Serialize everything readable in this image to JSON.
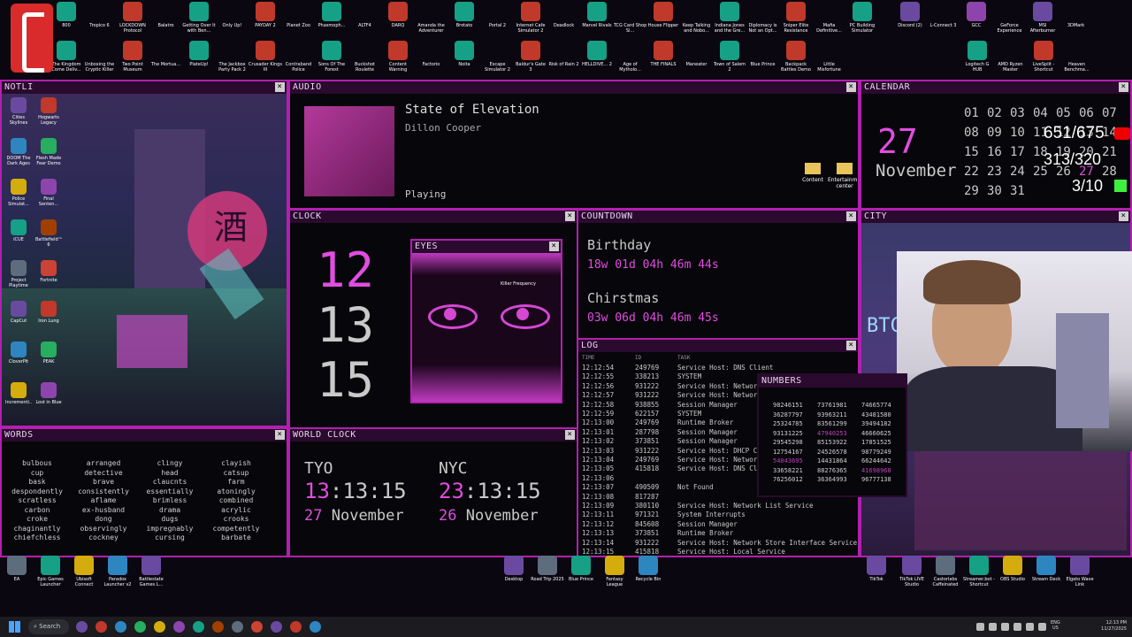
{
  "desktop_top_row1": [
    "800",
    "Tropico 6",
    "LOCKDOWN Protocol",
    "Balatro",
    "Getting Over It with Ben...",
    "Only Up!",
    "PAYDAY 2",
    "Planet Zoo",
    "Phasmoph...",
    "ALTF4",
    "DARQ",
    "Amanda the Adventurer",
    "Brotato",
    "Portal 2",
    "Internet Cafe Simulator 2",
    "Deadlock",
    "Marvel Rivals",
    "TCG Card Shop Si...",
    "House Flipper",
    "Keep Talking and Nobo...",
    "Indiana Jones and the Gre...",
    "Diplomacy is Not an Opt...",
    "Sniper Elite Resistance",
    "Mafia Definitive...",
    "PC Building Simulator",
    "Discord (2)",
    "L-Connect 3",
    "GCC",
    "GeForce Experience",
    "MSI Afterburner",
    "3DMark"
  ],
  "desktop_top_row2": [
    "The Kingdom Come Deliv...",
    "Unboxing the Cryptic Killer",
    "Two Point Museum",
    "The Mortua...",
    "PlateUp!",
    "The Jackbox Party Pack 2",
    "Crusader Kings III",
    "Contraband Police",
    "Sons Of The Forest",
    "Buckshot Roulette",
    "Content Warning",
    "Factorio",
    "Noita",
    "Escape Simulator 2",
    "Baldur's Gate 3",
    "Risk of Rain 2",
    "HELLDIVE... 2",
    "Age of Mytholo...",
    "THE FINALS",
    "Maneater",
    "Town of Salem 2",
    "Blue Prince",
    "Backpack Battles Demo",
    "Little Misfortune",
    "Logitech G HUB",
    "AMD Ryzen Master",
    "LiveSplit - Shortcut",
    "Heaven Benchma..."
  ],
  "audio": {
    "title": "AUDIO",
    "track": "State of Elevation",
    "artist": "Dillon Cooper",
    "status": "Playing",
    "folder1": "Content",
    "folder2": "Entertainm... center"
  },
  "calendar": {
    "title": "CALENDAR",
    "day": "27",
    "month": "November",
    "dates": [
      "01",
      "02",
      "03",
      "04",
      "05",
      "06",
      "07",
      "08",
      "09",
      "10",
      "11",
      "12",
      "13",
      "14",
      "15",
      "16",
      "17",
      "18",
      "19",
      "20",
      "21",
      "22",
      "23",
      "24",
      "25",
      "26",
      "27",
      "28",
      "29",
      "30",
      "31"
    ]
  },
  "overlay": {
    "counter1": "651/675",
    "counter2": "313/320",
    "counter3": "3/10"
  },
  "clock": {
    "title": "CLOCK",
    "h": "12",
    "m": "13",
    "s": "15"
  },
  "eyes": {
    "title": "EYES",
    "caption": "Killer Frequency"
  },
  "countdown": {
    "title": "COUNTDOWN",
    "e1_name": "Birthday",
    "e1_time": "18w 01d 04h 46m 44s",
    "e2_name": "Chirstmas",
    "e2_time": "03w 06d 04h 46m 45s"
  },
  "city": {
    "title": "CITY",
    "sign": "BTC"
  },
  "log": {
    "title": "LOG",
    "col_time": "TIME",
    "col_id": "ID",
    "col_task": "TASK",
    "rows": [
      [
        "12:12:54",
        "249769",
        "Service Host: DNS Client"
      ],
      [
        "12:12:55",
        "338213",
        "SYSTEM"
      ],
      [
        "12:12:56",
        "931222",
        "Service Host: Networ"
      ],
      [
        "12:12:57",
        "931222",
        "Service Host: Networ"
      ],
      [
        "12:12:58",
        "938855",
        "Session Manager"
      ],
      [
        "12:12:59",
        "622157",
        "SYSTEM"
      ],
      [
        "12:13:00",
        "249769",
        "Runtime Broker"
      ],
      [
        "12:13:01",
        "287798",
        "Session Manager"
      ],
      [
        "12:13:02",
        "373851",
        "Session Manager"
      ],
      [
        "12:13:03",
        "931222",
        "Service Host: DHCP C"
      ],
      [
        "12:13:04",
        "249769",
        "Service Host: Networ"
      ],
      [
        "12:13:05",
        "415818",
        "Service Host: DNS Cl"
      ],
      [
        "12:13:06",
        "",
        ""
      ],
      [
        "12:13:07",
        "490509",
        "Not Found"
      ],
      [
        "12:13:08",
        "817287",
        ""
      ],
      [
        "12:13:09",
        "380110",
        "Service Host: Network List Service"
      ],
      [
        "12:13:11",
        "971321",
        "System Interrupts"
      ],
      [
        "12:13:12",
        "845608",
        "Session Manager"
      ],
      [
        "12:13:13",
        "373851",
        "Runtime Broker"
      ],
      [
        "12:13:14",
        "931222",
        "Service Host: Network Store Interface Service"
      ],
      [
        "12:13:15",
        "415818",
        "Service Host: Local Service"
      ]
    ]
  },
  "numbers": {
    "title": "NUMBERS",
    "rows": [
      [
        "98246151",
        "73761981",
        "74665774"
      ],
      [
        "36287797",
        "93963211",
        "43481580"
      ],
      [
        "25324785",
        "83561299",
        "39494182"
      ],
      [
        "93131225",
        "47940253",
        "46660625"
      ],
      [
        "29545298",
        "85153922",
        "17851525"
      ],
      [
        "12754167",
        "24526578",
        "98779249"
      ],
      [
        "54043695",
        "14431864",
        "66244642"
      ],
      [
        "33658221",
        "88276365",
        "41698968"
      ],
      [
        "76256012",
        "36364993",
        "96777138"
      ]
    ]
  },
  "words": {
    "title": "WORDS",
    "cols": [
      [
        "bulbous",
        "cup",
        "bask",
        "despondently",
        "scratless",
        "carbon",
        "croke",
        "chaginantly",
        "chiefchless"
      ],
      [
        "arranged",
        "detective",
        "brave",
        "consistently",
        "aflame",
        "ex-husband",
        "dong",
        "observingly",
        "cockney"
      ],
      [
        "clingy",
        "head",
        "claucnts",
        "essentially",
        "brimless",
        "drama",
        "dugs",
        "impregnably",
        "cursing"
      ],
      [
        "clayish",
        "catsup",
        "farm",
        "atoningly",
        "combined",
        "acrylic",
        "crooks",
        "competently",
        "barbate"
      ]
    ]
  },
  "worldclock": {
    "title": "WORLD CLOCK",
    "c1": "TYO",
    "c1_h": "13",
    "c1_t": ":13:15",
    "c1_d_num": "27",
    "c1_d_month": "November",
    "c2": "NYC",
    "c2_h": "23",
    "c2_t": ":13:15",
    "c2_d_num": "26",
    "c2_d_month": "November"
  },
  "left_panel": {
    "title": "NOTLI",
    "sign": "酒",
    "icons": [
      "Cities Skylines",
      "Hogwarts Legacy",
      "DOOM The Dark Ages",
      "Flesh Made Fear Demo",
      "Police Simulat...",
      "Final Senten...",
      "iCUE",
      "Battlefield™ 6",
      "Project Playtime",
      "Fortnite",
      "CapCut",
      "Iron Lung",
      "CloverPit",
      "PEAK",
      "Incrementi...",
      "Lost in Blue"
    ]
  },
  "desktop_bottom": [
    "EA",
    "Epic Games Launcher",
    "Ubisoft Connect",
    "Paradox Launcher v2",
    "Battlestate Games L...",
    "Desktop",
    "Road Trip 2025",
    "Blue Prince",
    "Fantasy League",
    "Recycle Bin",
    "TikTok",
    "TikTok LIVE Studio",
    "Castorlabs Caffeinated",
    "Streamer.bot - Shortcut",
    "OBS Studio",
    "Stream Deck",
    "Elgato Wave Link"
  ],
  "taskbar": {
    "search": "Search",
    "lang1": "ENG",
    "lang2": "US",
    "time": "12:13 PM",
    "date": "11/27/2025"
  },
  "colors": {
    "accent": "#b31fb0",
    "pink": "#e04de0",
    "bg": "#07060a"
  }
}
